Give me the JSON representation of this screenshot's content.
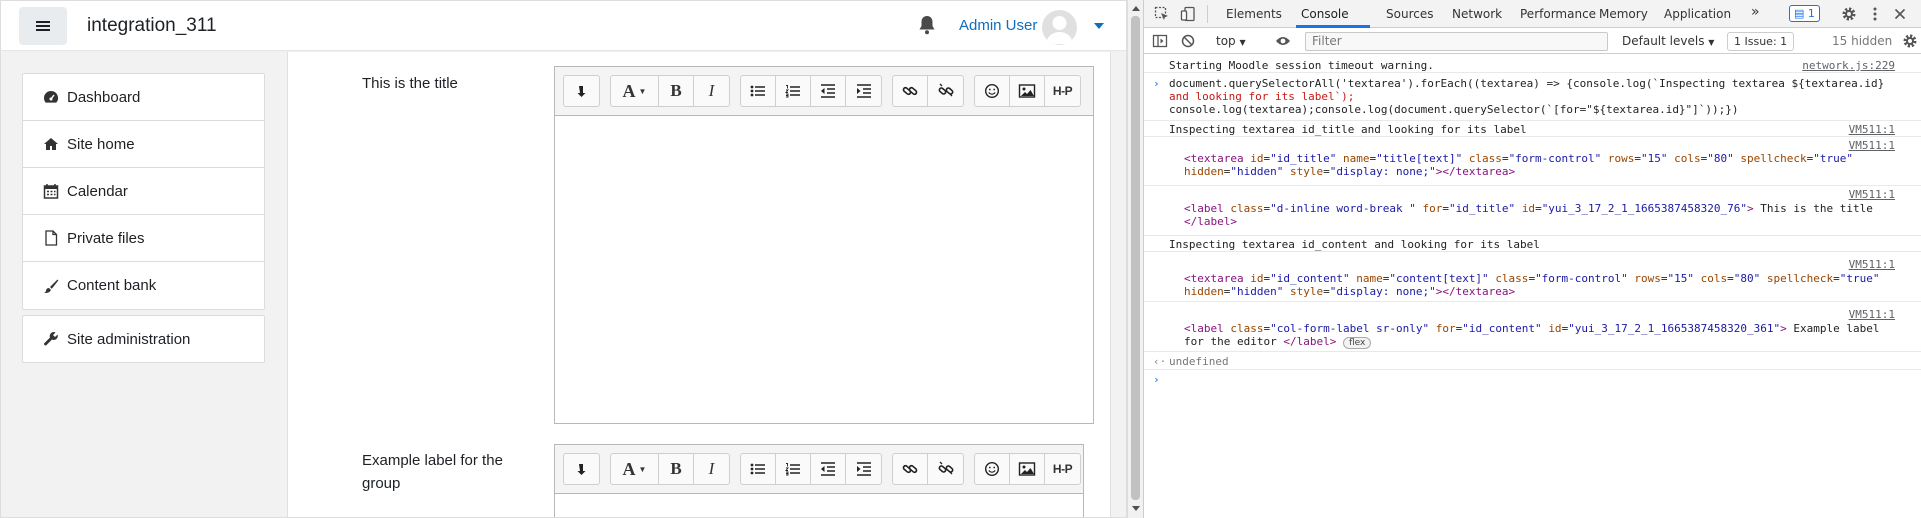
{
  "navbar": {
    "site_name": "integration_311",
    "user_name": "Admin User"
  },
  "drawer": {
    "items": [
      {
        "label": "Dashboard",
        "icon": "dashboard-icon"
      },
      {
        "label": "Site home",
        "icon": "home-icon"
      },
      {
        "label": "Calendar",
        "icon": "calendar-icon"
      },
      {
        "label": "Private files",
        "icon": "file-icon"
      },
      {
        "label": "Content bank",
        "icon": "brush-icon"
      }
    ],
    "admin": {
      "label": "Site administration",
      "icon": "wrench-icon"
    }
  },
  "form": {
    "field1_label": "This is the title",
    "field2_label": "Example label for the group",
    "toolbar": {
      "bold": "B",
      "italic": "I",
      "h5p": "H-P",
      "font": "A"
    }
  },
  "devtools": {
    "tabs": [
      "Elements",
      "Console",
      "Sources",
      "Network",
      "Performance",
      "Memory",
      "Application"
    ],
    "active_tab": "Console",
    "more": "»",
    "message_badge": "1",
    "context": "top",
    "filter_placeholder": "Filter",
    "levels": "Default levels",
    "issue_count": "1 Issue: 1",
    "hidden_count": "15 hidden",
    "console": {
      "warning": "Starting Moodle session timeout warning.",
      "warning_src": "network.js:229",
      "cmd1": "document.querySelectorAll('textarea').forEach((textarea) => {console.log(`Inspecting textarea ${textarea.id}",
      "cmd2": "and looking for its label`);",
      "cmd3": "console.log(textarea);console.log(document.querySelector(`[for=\"${textarea.id}\"]`));})",
      "log1": "Inspecting textarea id_title and looking for its label",
      "vm": "VM511:1",
      "log3": "Inspecting textarea id_content and looking for its label",
      "label2_text": "Example label",
      "undefined": "undefined",
      "flex": "flex"
    }
  }
}
